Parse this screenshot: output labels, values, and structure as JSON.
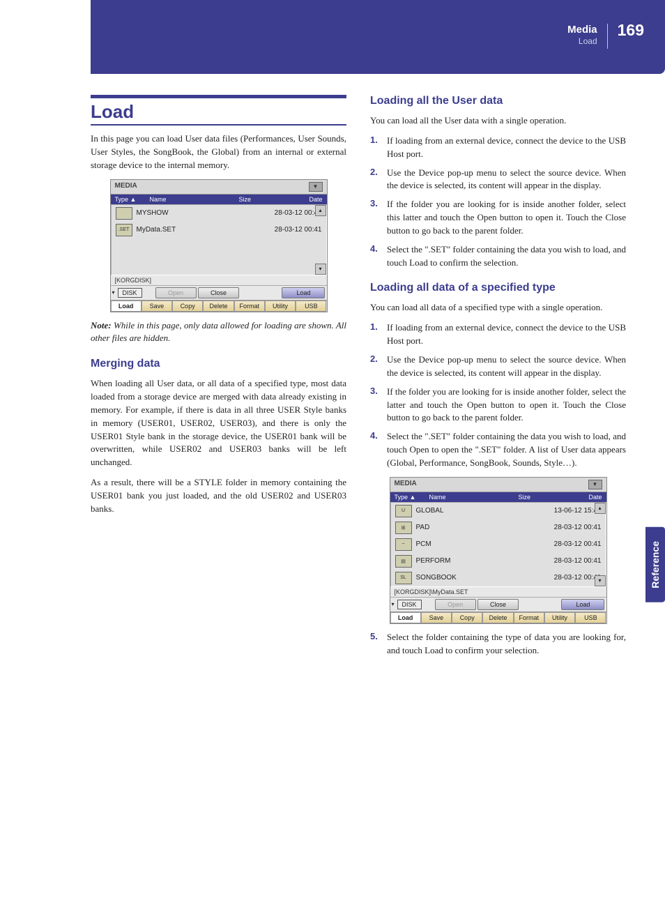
{
  "header": {
    "section": "Media",
    "subsection": "Load",
    "page": "169"
  },
  "sidetab": "Reference",
  "left": {
    "title": "Load",
    "intro": "In this page you can load User data files (Performances, User Sounds, User Styles, the SongBook, the Global) from an internal or external storage device to the internal memory.",
    "note_label": "Note:",
    "note": "While in this page, only data allowed for loading are shown. All other files are hidden.",
    "h_merging": "Merging data",
    "p_merge1": "When loading all User data, or all data of a specified type, most data loaded from a storage device are merged with data already existing in memory. For example, if there is data in all three USER Style banks in memory (USER01, USER02, USER03), and there is only the USER01 Style bank in the storage device, the USER01 bank will be overwritten, while USER02 and USER03 banks will be left unchanged.",
    "p_merge2": "As a result, there will be a STYLE folder in memory containing the USER01 bank you just loaded, and the old USER02 and USER03 banks."
  },
  "right": {
    "h_user": "Loading all the User data",
    "p_user_intro": "You can load all the User data with a single operation.",
    "steps_user": [
      "If loading from an external device, connect the device to the USB Host port.",
      "Use the Device pop-up menu to select the source device. When the device is selected, its content will appear in the display.",
      "If the folder you are looking for is inside another folder, select this latter and touch the Open button to open it. Touch the Close button to go back to the parent folder.",
      "Select the \".SET\" folder containing the data you wish to load, and touch Load to confirm the selection."
    ],
    "h_type": "Loading all data of a specified type",
    "p_type_intro": "You can load all data of a specified type with a single operation.",
    "steps_type": [
      "If loading from an external device, connect the device to the USB Host port.",
      "Use the Device pop-up menu to select the source device. When the device is selected, its content will appear in the display.",
      "If the folder you are looking for is inside another folder, select the latter and touch the Open button to open it. Touch the Close button to go back to the parent folder.",
      "Select the \".SET\" folder containing the data you wish to load, and touch Open to open the \".SET\" folder. A list of User data appears (Global, Performance, SongBook, Sounds, Style…)."
    ],
    "step5": "Select the folder containing the type of data you are looking for, and touch Load to confirm your selection."
  },
  "media_common": {
    "title": "MEDIA",
    "cols": {
      "type": "Type",
      "name": "Name",
      "size": "Size",
      "date": "Date"
    },
    "sort_arrow": "▲",
    "disk_label": "DISK",
    "btn_open": "Open",
    "btn_close": "Close",
    "btn_load": "Load",
    "tabs": [
      "Load",
      "Save",
      "Copy",
      "Delete",
      "Format",
      "Utility",
      "USB"
    ]
  },
  "media1": {
    "rows": [
      {
        "icon": "",
        "name": "MYSHOW",
        "date": "28-03-12 00:41"
      },
      {
        "icon": ".SET",
        "name": "MyData.SET",
        "date": "28-03-12 00:41"
      }
    ],
    "path": "[KORGDISK]"
  },
  "media2": {
    "rows": [
      {
        "icon": "U",
        "name": "GLOBAL",
        "date": "13-06-12 15:45"
      },
      {
        "icon": "⊞",
        "name": "PAD",
        "date": "28-03-12 00:41"
      },
      {
        "icon": "~",
        "name": "PCM",
        "date": "28-03-12 00:41"
      },
      {
        "icon": "▤",
        "name": "PERFORM",
        "date": "28-03-12 00:41"
      },
      {
        "icon": "SL",
        "name": "SONGBOOK",
        "date": "28-03-12 00:41"
      }
    ],
    "path": "[KORGDISK]\\MyData.SET"
  }
}
